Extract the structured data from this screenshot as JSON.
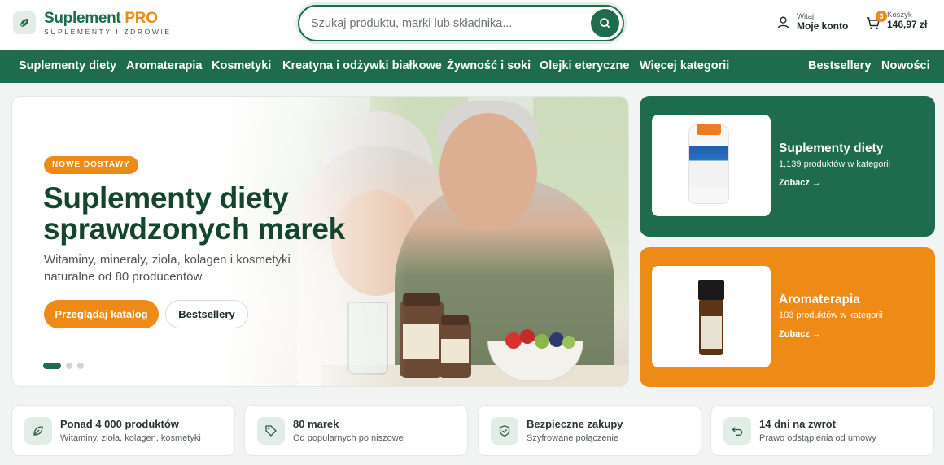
{
  "brand": {
    "name": "Suplement",
    "name_accent": "PRO",
    "tagline": "SUPLEMENTY I ZDROWIE"
  },
  "search": {
    "placeholder": "Szukaj produktu, marki lub składnika..."
  },
  "account": {
    "greeting": "Witaj",
    "label": "Moje konto"
  },
  "cart": {
    "label": "Koszyk",
    "total": "146,97 zł",
    "count": "3"
  },
  "nav": {
    "items": [
      "Suplementy diety",
      "Aromaterapia",
      "Kosmetyki",
      "Kreatyna i odżywki białkowe",
      "Żywność i soki",
      "Olejki eteryczne",
      "Więcej kategorii"
    ],
    "right": [
      "Bestsellery",
      "Nowości"
    ]
  },
  "hero": {
    "badge": "NOWE DOSTAWY",
    "title": "Suplementy diety sprawdzonych marek",
    "subtitle": "Witaminy, minerały, zioła, kolagen i kosmetyki naturalne od 80 producentów.",
    "primary_button": "Przeglądaj katalog",
    "secondary_button": "Bestsellery",
    "slides": 3,
    "active_slide": 1
  },
  "cards": [
    {
      "title": "Suplementy diety",
      "count": "1,139 produktów w kategorii",
      "link": "Zobacz →",
      "color": "#1e6b4e"
    },
    {
      "title": "Aromaterapia",
      "count": "103 produktów w kategorii",
      "link": "Zobacz →",
      "color": "#ee8a16"
    }
  ],
  "features": [
    {
      "icon": "leaf-icon",
      "title": "Ponad 4 000 produktów",
      "subtitle": "Witaminy, zioła, kolagen, kosmetyki"
    },
    {
      "icon": "tag-icon",
      "title": "80 marek",
      "subtitle": "Od popularnych po niszowe"
    },
    {
      "icon": "shield-icon",
      "title": "Bezpieczne zakupy",
      "subtitle": "Szyfrowane połączenie"
    },
    {
      "icon": "return-icon",
      "title": "14 dni na zwrot",
      "subtitle": "Prawo odstąpienia od umowy"
    }
  ],
  "colors": {
    "primary": "#1e6b4e",
    "accent": "#ee8a16",
    "background": "#f2f4f3"
  }
}
